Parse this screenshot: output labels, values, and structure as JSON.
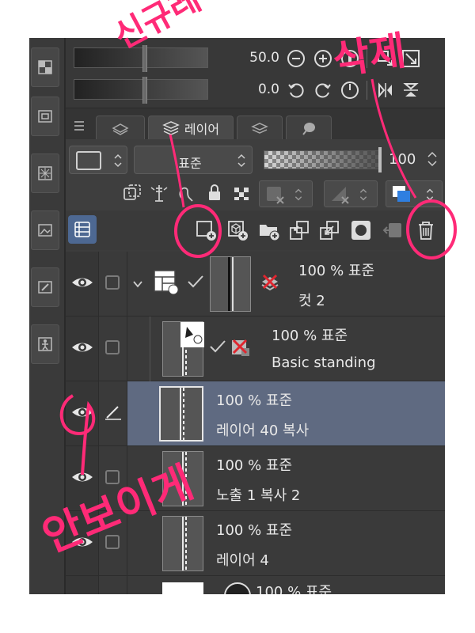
{
  "navigator": {
    "zoom_value": "50.0",
    "rotate_value": "0.0"
  },
  "layer_panel": {
    "tab_label": "레이어",
    "blend_mode": "표준",
    "opacity": "100"
  },
  "layers": [
    {
      "line1": "100 % 표준",
      "line2": "컷 2"
    },
    {
      "line1": "100 % 표준",
      "line2": "Basic standing"
    },
    {
      "line1": "100 % 표준",
      "line2": "레이어 40 복사"
    },
    {
      "line1": "100 % 표준",
      "line2": "노출 1 복사 2"
    },
    {
      "line1": "100 % 표준",
      "line2": "레이어 4"
    },
    {
      "line1": "100 % 표준",
      "line2": ""
    }
  ],
  "annotations": {
    "new_layer": "신규레이어",
    "delete": "삭제",
    "hide": "안보이게"
  },
  "colors": {
    "annotation": "#ff2a77",
    "selected_row": "#5f6a81",
    "accent_blue": "#4d6892"
  }
}
